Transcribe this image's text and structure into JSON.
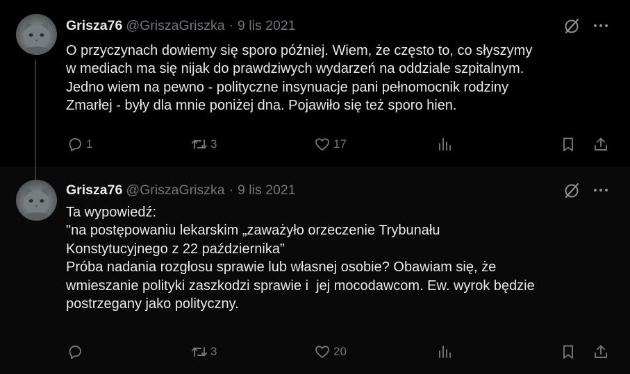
{
  "tweets": [
    {
      "author_name": "Grisza76",
      "author_handle": "@GriszaGriszka",
      "separator": "·",
      "date": "9 lis 2021",
      "text": "O przyczynach dowiemy się sporo później. Wiem, że często to, co słyszymy\nw mediach ma się nijak do prawdziwych wydarzeń na oddziale szpitalnym.\nJedno wiem na pewno - polityczne insynuacje pani pełnomocnik rodziny\nZmarłej - były dla mnie poniżej dna. Pojawiło się też sporo hien.",
      "replies": "1",
      "retweets": "3",
      "likes": "17"
    },
    {
      "author_name": "Grisza76",
      "author_handle": "@GriszaGriszka",
      "separator": "·",
      "date": "9 lis 2021",
      "text": "Ta wypowiedź:\n\"na postępowaniu lekarskim „zaważyło orzeczenie Trybunału\nKonstytucyjnego z 22 października”\nPróba nadania rozgłosu sprawie lub własnej osobie? Obawiam się, że\nwmieszanie polityki zaszkodzi sprawie i  jej mocodawcom. Ew. wyrok będzie\npostrzegany jako polityczny.",
      "replies": "",
      "retweets": "3",
      "likes": "20"
    }
  ],
  "icons": {
    "grok": "grok-icon",
    "more": "more-icon",
    "reply": "reply-icon",
    "retweet": "retweet-icon",
    "like": "heart-icon",
    "views": "views-icon",
    "bookmark": "bookmark-icon",
    "share": "share-icon"
  },
  "colors": {
    "background": "#000000",
    "text": "#e7e9ea",
    "muted": "#71767b"
  }
}
